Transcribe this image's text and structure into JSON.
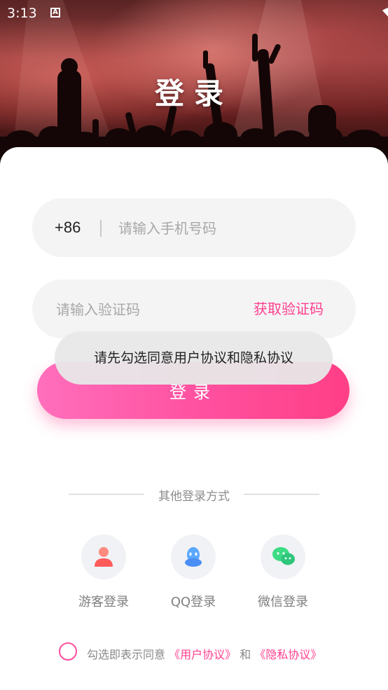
{
  "status_bar": {
    "time": "3:13",
    "notification_icon": "A"
  },
  "header": {
    "title": "登录"
  },
  "phone": {
    "country_code": "+86",
    "placeholder": "请输入手机号码"
  },
  "verification": {
    "placeholder": "请输入验证码",
    "get_code_label": "获取验证码"
  },
  "login_button": {
    "label": "登录"
  },
  "toast": {
    "message": "请先勾选同意用户协议和隐私协议"
  },
  "other_login": {
    "title": "其他登录方式",
    "options": [
      {
        "label": "游客登录",
        "icon": "guest-person-icon"
      },
      {
        "label": "QQ登录",
        "icon": "qq-penguin-icon"
      },
      {
        "label": "微信登录",
        "icon": "wechat-icon"
      }
    ]
  },
  "agreement": {
    "prefix": "勾选即表示同意",
    "user_agreement": "《用户协议》",
    "connector": "和",
    "privacy_agreement": "《隐私协议》"
  },
  "colors": {
    "accent": "#ff3f8e",
    "button_start": "#ff6fbc",
    "button_end": "#ff3f86",
    "field_bg": "#f4f4f5"
  }
}
